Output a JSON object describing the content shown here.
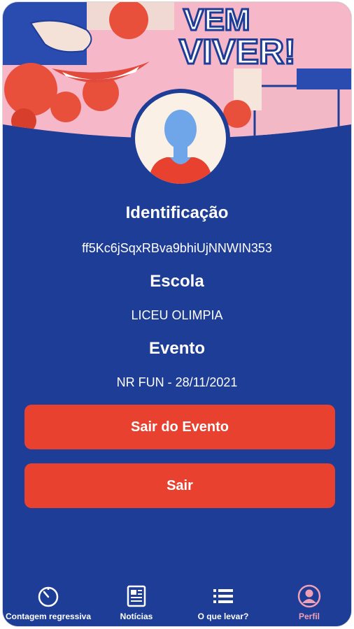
{
  "hero": {
    "banner_text_line1": "VEM",
    "banner_text_line2": "VIVER!"
  },
  "profile": {
    "id_title": "Identificação",
    "id_value": "ff5Kc6jSqxRBva9bhiUjNNWIN353",
    "school_title": "Escola",
    "school_value": "LICEU OLIMPIA",
    "event_title": "Evento",
    "event_value": "NR FUN - 28/11/2021"
  },
  "actions": {
    "leave_event_label": "Sair do Evento",
    "logout_label": "Sair"
  },
  "tabs": [
    {
      "label": "Contagem regressiva",
      "icon": "timer-icon"
    },
    {
      "label": "Notícias",
      "icon": "newspaper-icon"
    },
    {
      "label": "O que levar?",
      "icon": "list-icon"
    },
    {
      "label": "Perfil",
      "icon": "user-circle-icon",
      "active": true
    }
  ],
  "colors": {
    "background": "#1e3d96",
    "button": "#e8412f",
    "active_tab": "#f0a0b4"
  }
}
